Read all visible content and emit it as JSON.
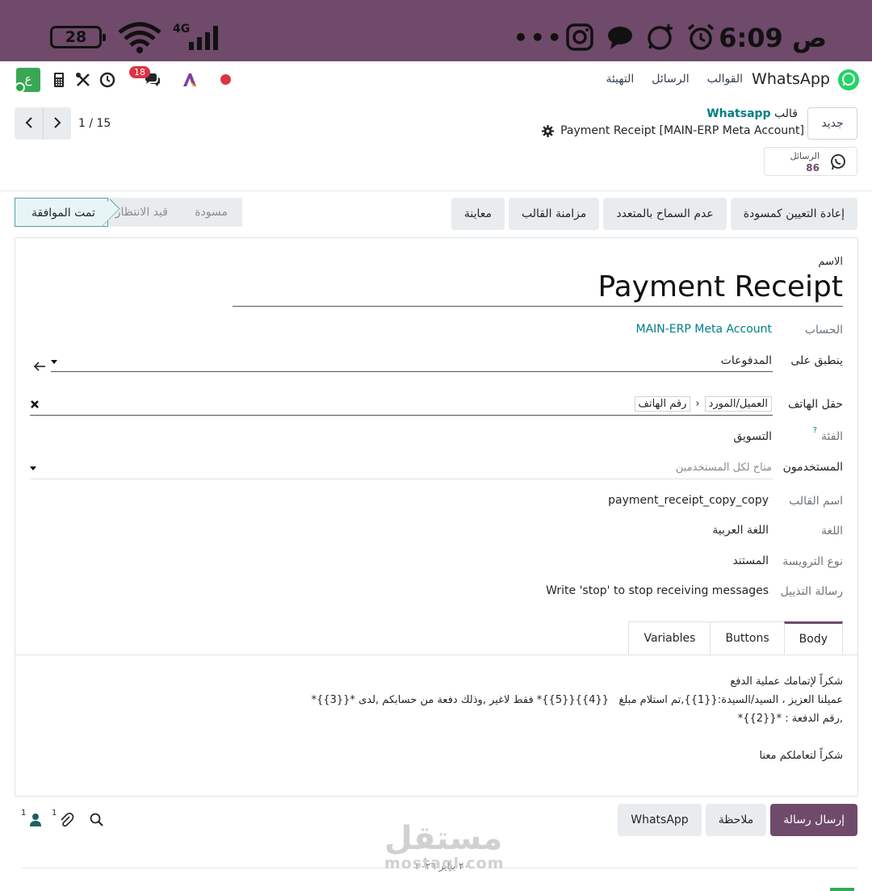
{
  "status_bar": {
    "time": "6:09",
    "period": "ص",
    "battery": "28",
    "network": "4G"
  },
  "nav": {
    "brand": "WhatsApp",
    "menu": [
      "القوالب",
      "الرسائل",
      "التهيئة"
    ],
    "app_letter": "ع",
    "chat_badge": "18"
  },
  "control": {
    "new_button": "جديد",
    "breadcrumb_prefix": "قالب",
    "breadcrumb_parent": "Whatsapp",
    "breadcrumb_current": "Payment Receipt [MAIN-ERP Meta Account]",
    "smart_label": "الرسائل",
    "smart_value": "86",
    "pager": "1 / 15"
  },
  "actions": [
    "إعادة التعيين كمسودة",
    "عدم السماح بالمتعدد",
    "مزامنة القالب",
    "معاينة"
  ],
  "states": {
    "approved": "تمت الموافقة",
    "pending": "قيد الانتظار",
    "draft": "مسودة"
  },
  "form": {
    "name_label": "الاسم",
    "name_value": "Payment Receipt",
    "account_label": "الحساب",
    "account_value": "MAIN-ERP Meta Account",
    "applies_label": "ينطبق على",
    "applies_value": "المدفوعات",
    "phone_label": "حقل الهاتف",
    "phone_tag1": "العميل/المورد",
    "phone_tag2": "رقم الهاتف",
    "category_label": "الفئة",
    "category_help": "?",
    "category_value": "التسويق",
    "users_label": "المستخدمون",
    "users_placeholder": "متاح لكل المستخدمين",
    "template_name_label": "اسم القالب",
    "template_name_value": "payment_receipt_copy_copy",
    "language_label": "اللغة",
    "language_value": "اللغة العربية",
    "header_label": "نوع الترويسة",
    "header_value": "المستند",
    "footer_label": "رسالة التذييل",
    "footer_value": "Write 'stop' to stop receiving messages"
  },
  "tabs": [
    "Body",
    "Buttons",
    "Variables"
  ],
  "body_lines": [
    "شكراً لإتمامك عملية الدفع",
    "عميلنا العزيز ، السيد/السيدة:{{1}},تم استلام مبلغ   {{4}}{{5}}* فقط لاغير ,وذلك دفعة من حسابكم ,لدى *{{3}}*",
    ",رقم الدفعة : *{{2}}*",
    "",
    "شكراً لتعاملكم معنا"
  ],
  "chatter": {
    "send_message": "إرسال رسالة",
    "note": "ملاحظة",
    "whatsapp": "WhatsApp",
    "attachments_count": "1",
    "followers_count": "1",
    "date_separator": "٢٠ يناير ٢٠٢٦"
  },
  "watermark": {
    "arabic": "مستقل",
    "latin": "mostaql.com"
  },
  "colors": {
    "primary": "#6f4a6a",
    "link": "#017e84",
    "status_bar": "#6f4a6a",
    "whatsapp_green": "#25d366",
    "badge_red": "#dc3545"
  }
}
